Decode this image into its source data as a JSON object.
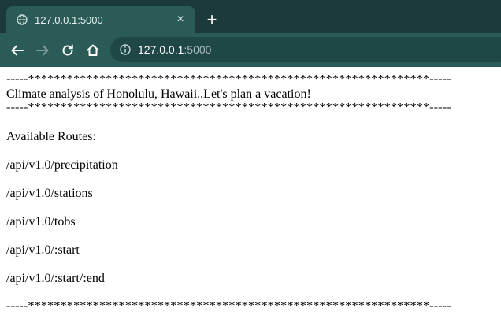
{
  "browser": {
    "tab_title": "127.0.0.1:5000",
    "tab_close": "×",
    "new_tab": "+",
    "url_host": "127.0.0.1",
    "url_port": ":5000"
  },
  "page": {
    "rule_line": "-----**************************************************************-----",
    "heading": "Climate analysis of Honolulu, Hawaii..Let's plan a vacation!",
    "routes_title": "Available Routes:",
    "routes": [
      "/api/v1.0/precipitation",
      "/api/v1.0/stations",
      "/api/v1.0/tobs",
      "/api/v1.0/:start",
      "/api/v1.0/:start/:end"
    ]
  },
  "colors": {
    "tabstrip": "#1c3a3a",
    "toolbar": "#2a5b57",
    "omnibox": "#1f4745"
  }
}
